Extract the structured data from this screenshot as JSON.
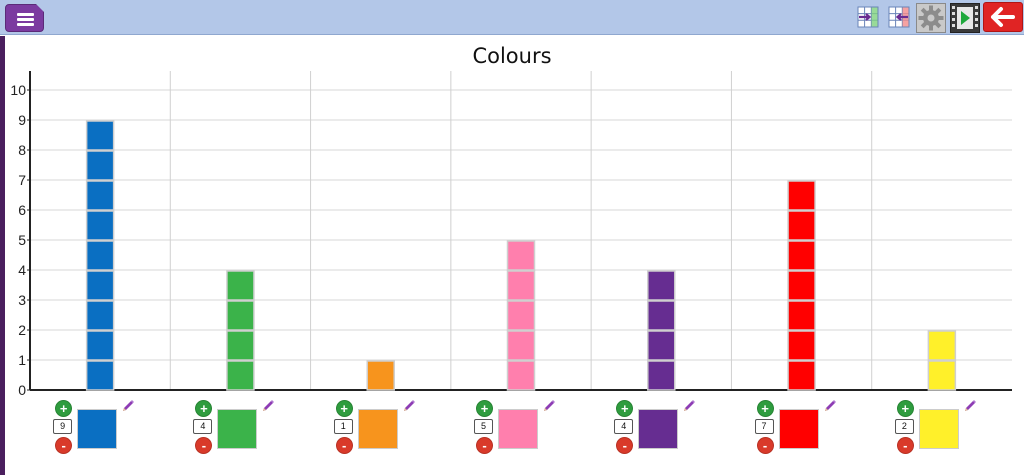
{
  "toolbar": {
    "menu_icon": "hamburger-menu-icon",
    "tools": [
      {
        "name": "insert-column-right-icon",
        "interactable": true
      },
      {
        "name": "insert-column-left-icon",
        "interactable": true
      },
      {
        "name": "gear-icon",
        "interactable": true
      },
      {
        "name": "play-film-icon",
        "interactable": true
      }
    ],
    "back_icon": "back-arrow-icon",
    "colors": {
      "bar": "#b3c7e8",
      "menu": "#7b3aa0",
      "back": "#e02424"
    }
  },
  "chart_data": {
    "type": "bar",
    "title": "Colours",
    "xlabel": "",
    "ylabel": "",
    "ylim": [
      0,
      10
    ],
    "yticks": [
      "0",
      "1",
      "2",
      "3",
      "4",
      "5",
      "6",
      "7",
      "8",
      "9",
      "10"
    ],
    "grid": true,
    "categories": [
      "Blue",
      "Green",
      "Orange",
      "Pink",
      "Purple",
      "Red",
      "Yellow"
    ],
    "values": [
      9,
      4,
      1,
      5,
      4,
      7,
      2
    ],
    "colors": [
      "#0a6fc2",
      "#3bb34a",
      "#f7941d",
      "#ff7fad",
      "#662d91",
      "#ff0000",
      "#fff02a"
    ]
  },
  "controls": {
    "plus_label": "+",
    "minus_label": "-",
    "counts": [
      "9",
      "4",
      "1",
      "5",
      "4",
      "7",
      "2"
    ]
  }
}
